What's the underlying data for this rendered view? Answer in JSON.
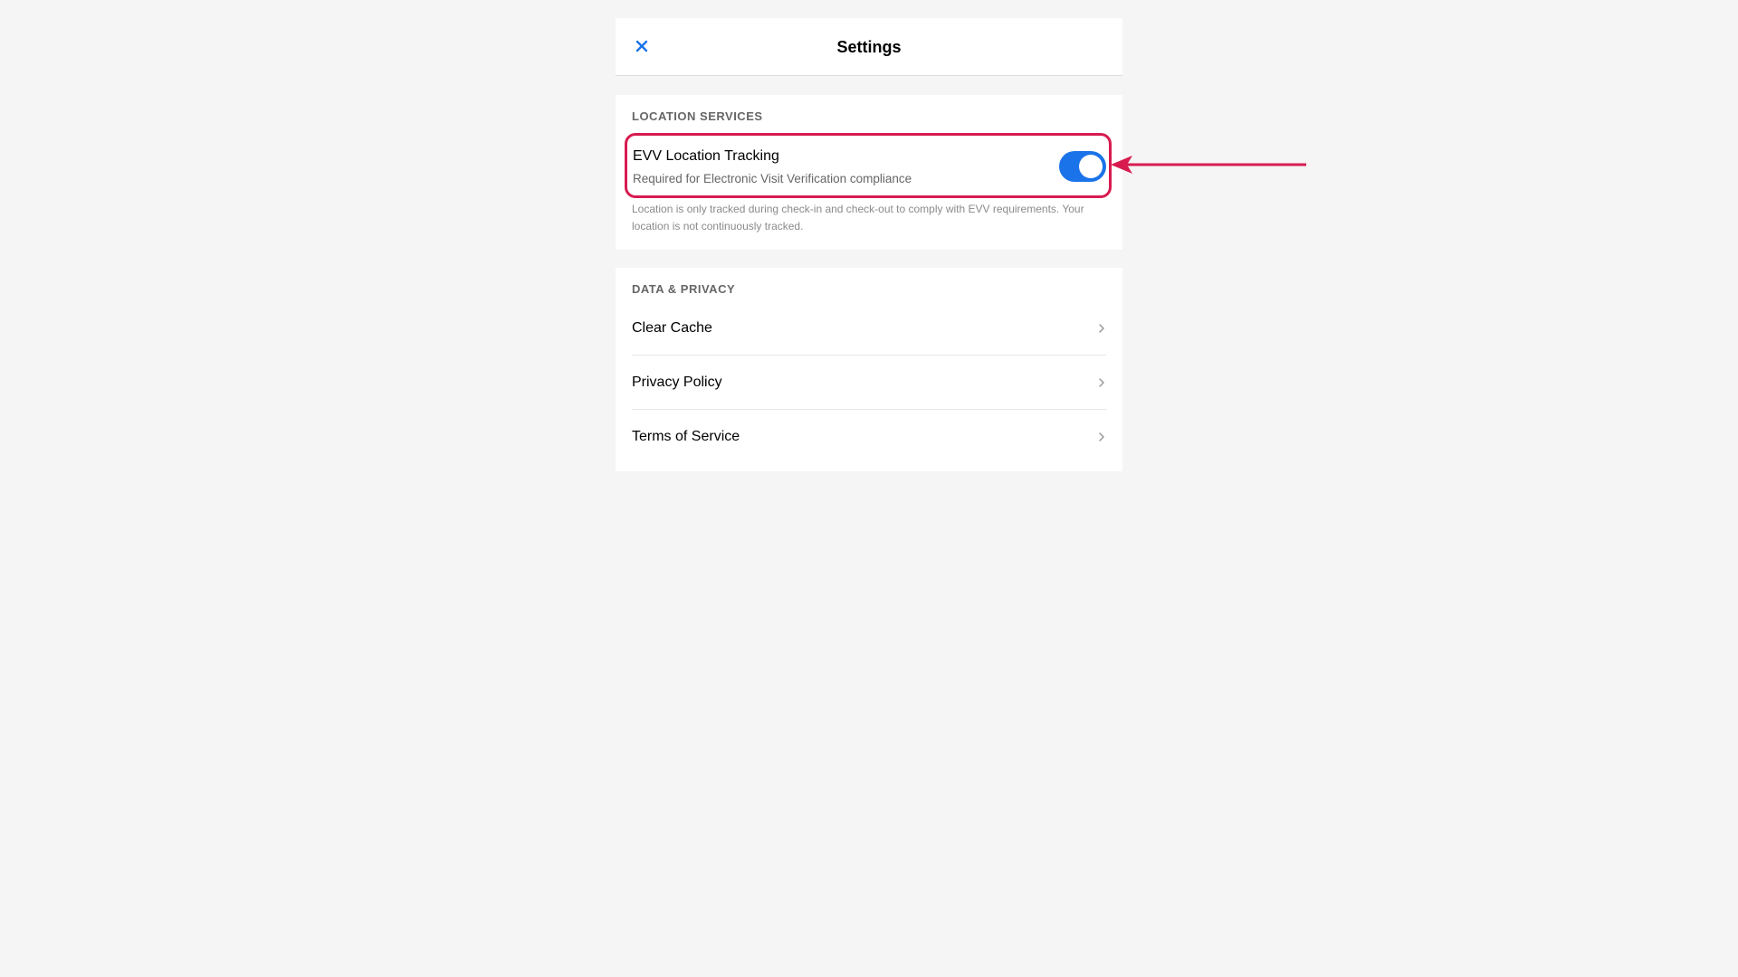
{
  "header": {
    "title": "Settings",
    "close_icon": "close-icon",
    "accent_color": "#1a73e8"
  },
  "location_services": {
    "section_title": "LOCATION SERVICES",
    "evv_tracking": {
      "label": "EVV Location Tracking",
      "description": "Required for Electronic Visit Verification compliance",
      "enabled": true
    },
    "note": "Location is only tracked during check-in and check-out to comply with EVV requirements. Your location is not continuously tracked."
  },
  "data_privacy": {
    "section_title": "DATA & PRIVACY",
    "items": [
      {
        "label": "Clear Cache",
        "icon": "chevron-right-icon"
      },
      {
        "label": "Privacy Policy",
        "icon": "chevron-right-icon"
      },
      {
        "label": "Terms of Service",
        "icon": "chevron-right-icon"
      }
    ]
  },
  "annotation": {
    "highlight_color": "#d81b4f",
    "icon": "arrow-left-icon"
  }
}
